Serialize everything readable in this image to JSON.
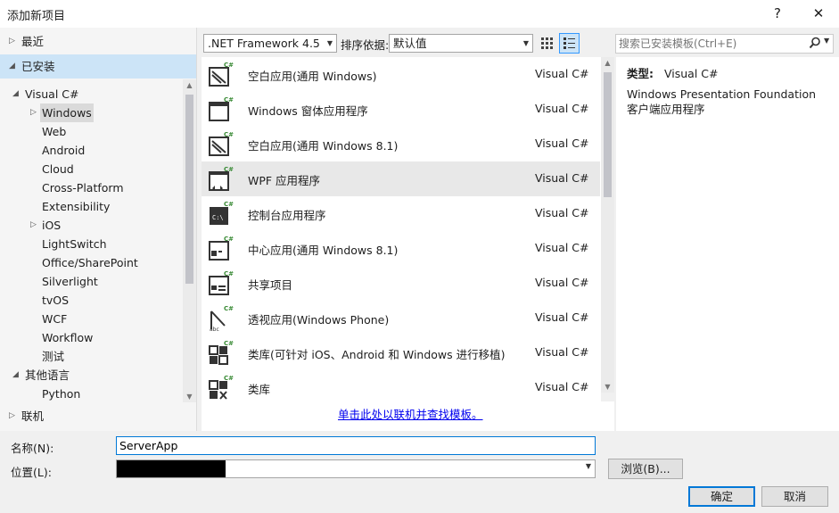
{
  "window": {
    "title": "添加新项目",
    "help_label": "?",
    "close_label": "✕"
  },
  "left": {
    "recent": "最近",
    "installed": "已安装",
    "online": "联机",
    "tree": [
      {
        "label": "Visual C#",
        "arrow": "◢"
      },
      {
        "label": "Windows",
        "arrow": "▷"
      },
      {
        "label": "Web",
        "arrow": ""
      },
      {
        "label": "Android",
        "arrow": ""
      },
      {
        "label": "Cloud",
        "arrow": ""
      },
      {
        "label": "Cross-Platform",
        "arrow": ""
      },
      {
        "label": "Extensibility",
        "arrow": ""
      },
      {
        "label": "iOS",
        "arrow": "▷"
      },
      {
        "label": "LightSwitch",
        "arrow": ""
      },
      {
        "label": "Office/SharePoint",
        "arrow": ""
      },
      {
        "label": "Silverlight",
        "arrow": ""
      },
      {
        "label": "tvOS",
        "arrow": ""
      },
      {
        "label": "WCF",
        "arrow": ""
      },
      {
        "label": "Workflow",
        "arrow": ""
      },
      {
        "label": "测试",
        "arrow": ""
      },
      {
        "label": "其他语言",
        "arrow": "◢"
      },
      {
        "label": "Python",
        "arrow": ""
      }
    ]
  },
  "toolbar": {
    "framework": ".NET Framework 4.5",
    "sort_label": "排序依据:",
    "sort_value": "默认值",
    "search_placeholder": "搜索已安装模板(Ctrl+E)"
  },
  "templates": [
    {
      "name": "空白应用(通用 Windows)",
      "lang": "Visual C#",
      "icon": "blank-app-icon"
    },
    {
      "name": "Windows 窗体应用程序",
      "lang": "Visual C#",
      "icon": "windows-forms-icon"
    },
    {
      "name": "空白应用(通用 Windows 8.1)",
      "lang": "Visual C#",
      "icon": "blank-app-icon"
    },
    {
      "name": "WPF 应用程序",
      "lang": "Visual C#",
      "icon": "wpf-app-icon"
    },
    {
      "name": "控制台应用程序",
      "lang": "Visual C#",
      "icon": "console-app-icon"
    },
    {
      "name": "中心应用(通用 Windows 8.1)",
      "lang": "Visual C#",
      "icon": "hub-app-icon"
    },
    {
      "name": "共享项目",
      "lang": "Visual C#",
      "icon": "shared-project-icon"
    },
    {
      "name": "透视应用(Windows Phone)",
      "lang": "Visual C#",
      "icon": "pivot-app-icon"
    },
    {
      "name": "类库(可针对 iOS、Android 和 Windows 进行移植)",
      "lang": "Visual C#",
      "icon": "portable-class-library-icon"
    },
    {
      "name": "类库",
      "lang": "Visual C#",
      "icon": "class-library-icon"
    }
  ],
  "online_link": "单击此处以联机并查找模板。",
  "details": {
    "type_label": "类型:",
    "type_value": "Visual C#",
    "description": "Windows Presentation Foundation 客户端应用程序"
  },
  "form": {
    "name_label": "名称(N):",
    "name_value": "ServerApp",
    "location_label": "位置(L):",
    "browse_label": "浏览(B)...",
    "ok_label": "确定",
    "cancel_label": "取消"
  },
  "colors": {
    "selected_section": "#cce4f7",
    "selected_row": "#e8e8e8",
    "link": "#0000ee",
    "accent": "#0078d7"
  }
}
